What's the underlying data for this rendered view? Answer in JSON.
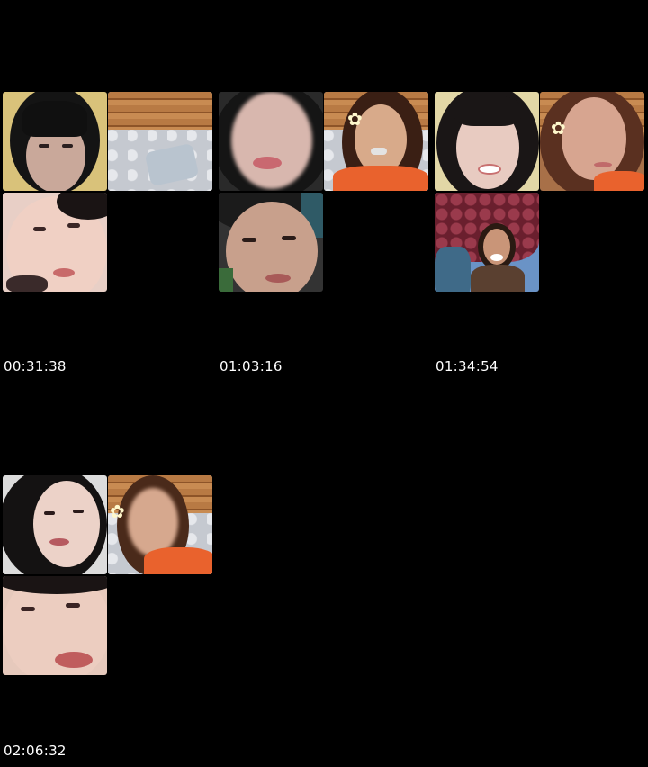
{
  "frames": [
    {
      "timestamp": "00:31:38"
    },
    {
      "timestamp": "01:03:16"
    },
    {
      "timestamp": "01:34:54"
    },
    {
      "timestamp": "02:06:32"
    }
  ],
  "colors": {
    "background": "#000000",
    "timestamp_text": "#ffffff"
  }
}
